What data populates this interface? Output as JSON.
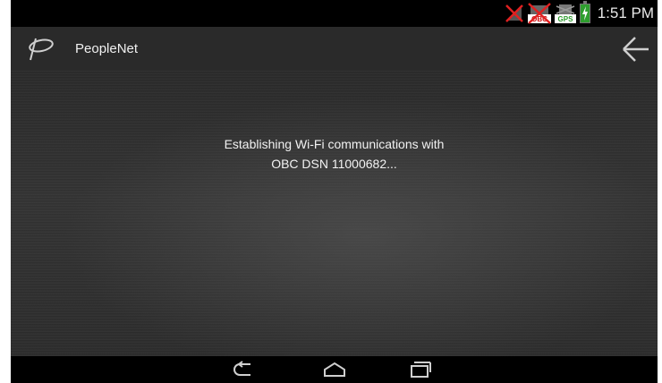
{
  "status_bar": {
    "time": "1:51 PM",
    "icons": [
      "signal-off-icon",
      "obc-off-icon",
      "gps-icon",
      "battery-charging-icon"
    ],
    "obc_label": "OBC",
    "gps_label": "GPS"
  },
  "action_bar": {
    "title": "PeopleNet",
    "logo": "peoplenet-logo",
    "back_icon": "back-arrow-icon"
  },
  "main": {
    "message_line1": "Establishing Wi-Fi communications with",
    "message_line2": "OBC DSN 11000682..."
  },
  "nav_bar": {
    "buttons": [
      "back-nav-icon",
      "home-nav-icon",
      "recents-nav-icon"
    ]
  },
  "colors": {
    "status_alert": "#e02020",
    "battery": "#2e9e2e",
    "actionbar_bg": "#2a2a2a",
    "text": "#f2f2f2"
  }
}
